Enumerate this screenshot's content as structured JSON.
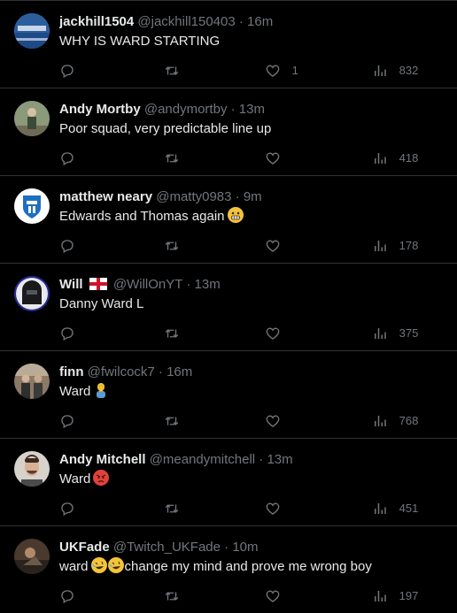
{
  "tweets": [
    {
      "name": "jackhill1504",
      "handle": "@jackhill150403",
      "separator": "·",
      "time": "16m",
      "text": "WHY IS WARD STARTING",
      "likes": "1",
      "views": "832",
      "avatar_icon": "stadium-photo-avatar",
      "avatar_color": "#3a6fb5"
    },
    {
      "name": "Andy Mortby",
      "handle": "@andymortby",
      "separator": "·",
      "time": "13m",
      "text": "Poor squad, very predictable line up",
      "likes": "",
      "views": "418",
      "avatar_icon": "person-photo-avatar",
      "avatar_color": "#7a8a6a"
    },
    {
      "name": "matthew neary",
      "handle": "@matty0983",
      "separator": "·",
      "time": "9m",
      "text": "Edwards and Thomas again",
      "emoji": "grimacing-face-emoji",
      "likes": "",
      "views": "178",
      "avatar_icon": "club-crest-avatar",
      "avatar_color": "#1d6fc4"
    },
    {
      "name": "Will",
      "flag": "england-flag-emoji",
      "handle": "@WillOnYT",
      "separator": "·",
      "time": "13m",
      "text": "Danny Ward L",
      "likes": "",
      "views": "375",
      "avatar_icon": "helmet-avatar",
      "avatar_color": "#2a2a6a"
    },
    {
      "name": "finn",
      "handle": "@fwilcock7",
      "separator": "·",
      "time": "16m",
      "text": "Ward",
      "emoji": "person-facepalming-emoji",
      "likes": "",
      "views": "768",
      "avatar_icon": "group-photo-avatar",
      "avatar_color": "#6b5a48"
    },
    {
      "name": "Andy Mitchell",
      "handle": "@meandymitchell",
      "separator": "·",
      "time": "13m",
      "text": "Ward",
      "emoji": "angry-face-emoji",
      "likes": "",
      "views": "451",
      "avatar_icon": "portrait-avatar",
      "avatar_color": "#b8a89a"
    },
    {
      "name": "UKFade",
      "handle": "@Twitch_UKFade",
      "separator": "·",
      "time": "10m",
      "text_before": "ward",
      "emoji": "rolling-on-floor-laughing-emoji",
      "text_after": "change my mind and prove me wrong boy",
      "likes": "",
      "views": "197",
      "avatar_icon": "photo-avatar",
      "avatar_color": "#5a4a3a"
    }
  ]
}
